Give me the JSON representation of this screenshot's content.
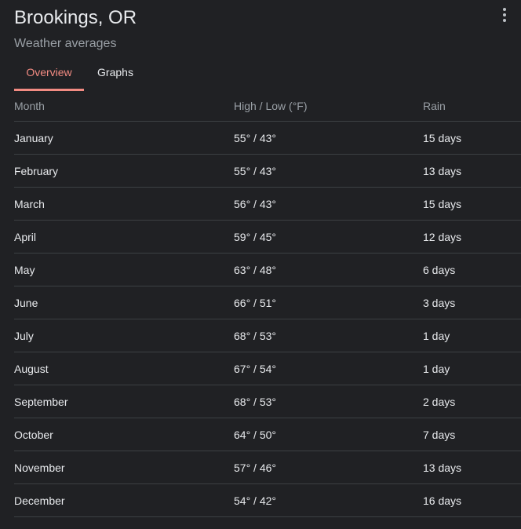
{
  "header": {
    "title": "Brookings, OR",
    "subtitle": "Weather averages"
  },
  "tabs": [
    {
      "label": "Overview",
      "active": true
    },
    {
      "label": "Graphs",
      "active": false
    }
  ],
  "table": {
    "columns": [
      "Month",
      "High / Low (°F)",
      "Rain"
    ],
    "rows": [
      {
        "month": "January",
        "temp": "55° / 43°",
        "rain": "15 days"
      },
      {
        "month": "February",
        "temp": "55° / 43°",
        "rain": "13 days"
      },
      {
        "month": "March",
        "temp": "56° / 43°",
        "rain": "15 days"
      },
      {
        "month": "April",
        "temp": "59° / 45°",
        "rain": "12 days"
      },
      {
        "month": "May",
        "temp": "63° / 48°",
        "rain": "6 days"
      },
      {
        "month": "June",
        "temp": "66° / 51°",
        "rain": "3 days"
      },
      {
        "month": "July",
        "temp": "68° / 53°",
        "rain": "1 day"
      },
      {
        "month": "August",
        "temp": "67° / 54°",
        "rain": "1 day"
      },
      {
        "month": "September",
        "temp": "68° / 53°",
        "rain": "2 days"
      },
      {
        "month": "October",
        "temp": "64° / 50°",
        "rain": "7 days"
      },
      {
        "month": "November",
        "temp": "57° / 46°",
        "rain": "13 days"
      },
      {
        "month": "December",
        "temp": "54° / 42°",
        "rain": "16 days"
      }
    ]
  },
  "icons": {
    "more": "more-vert-icon"
  },
  "colors": {
    "background": "#202124",
    "accent": "#f28b82",
    "text": "#e8eaed",
    "muted_text": "#9aa0a6",
    "divider": "#3c4043"
  }
}
